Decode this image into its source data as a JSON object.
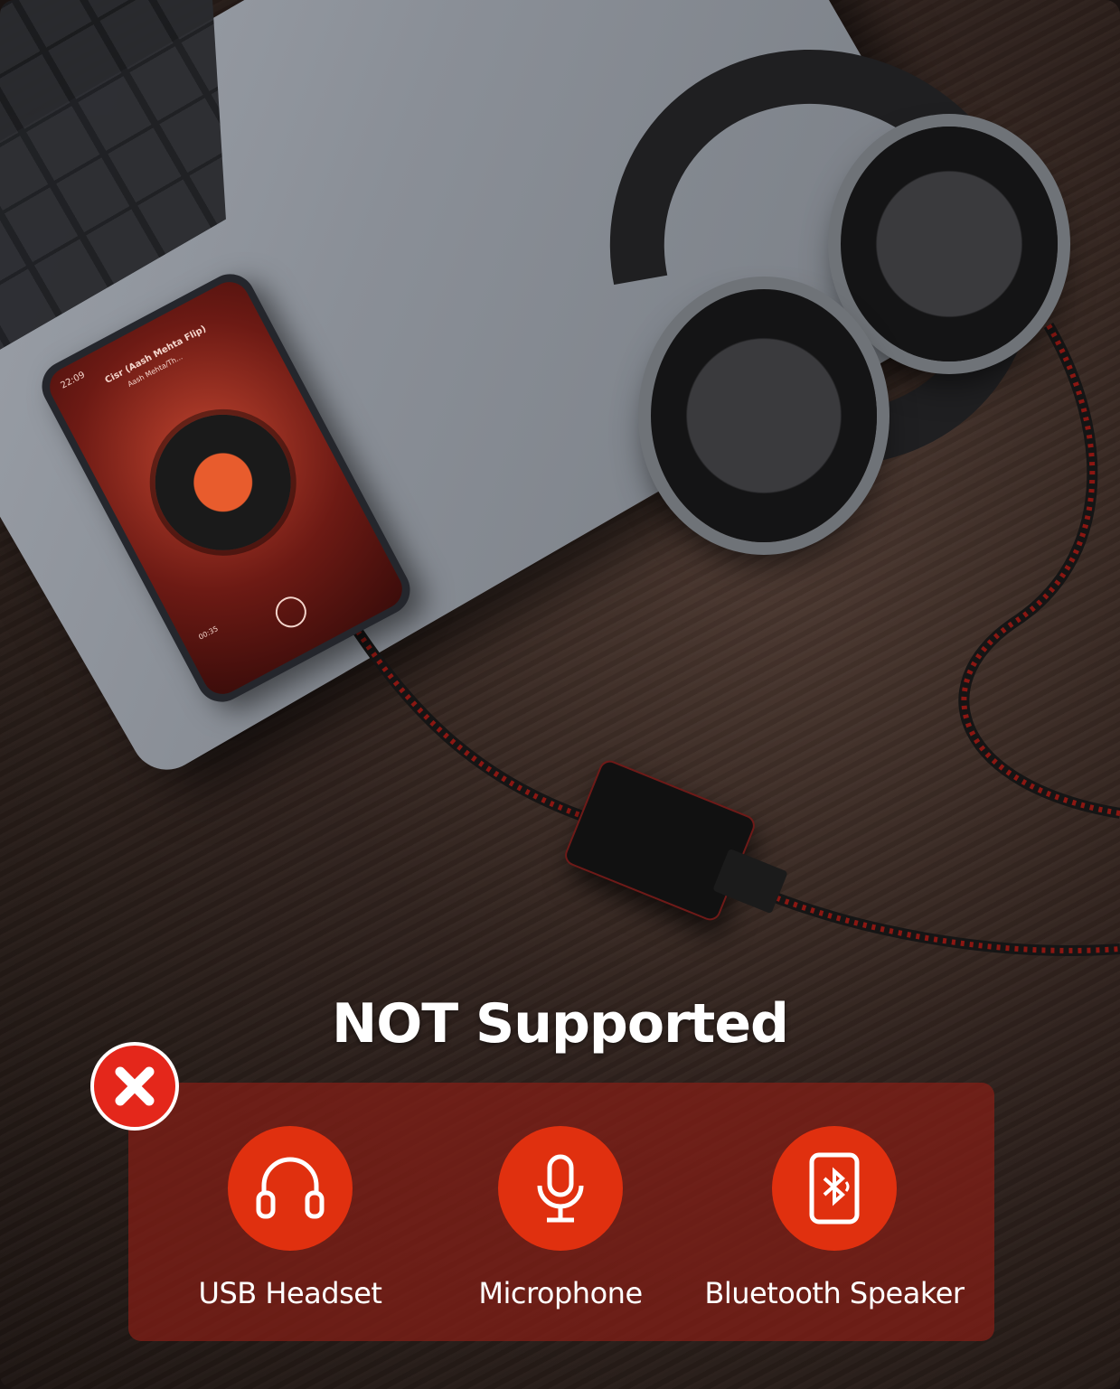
{
  "phone": {
    "time": "22:09",
    "track_title": "Cisr (Aash Mehta Flip)",
    "track_artist": "Aash Mehta/Th...",
    "elapsed": "00:35"
  },
  "banner": {
    "title": "NOT Supported",
    "items": [
      {
        "label": "USB Headset",
        "icon": "headphones-icon"
      },
      {
        "label": "Microphone",
        "icon": "microphone-icon"
      },
      {
        "label": "Bluetooth Speaker",
        "icon": "bluetooth-speaker-icon"
      }
    ]
  },
  "colors": {
    "accent_red": "#e0300f",
    "panel_red": "#871e16",
    "badge_red": "#e4271b"
  }
}
